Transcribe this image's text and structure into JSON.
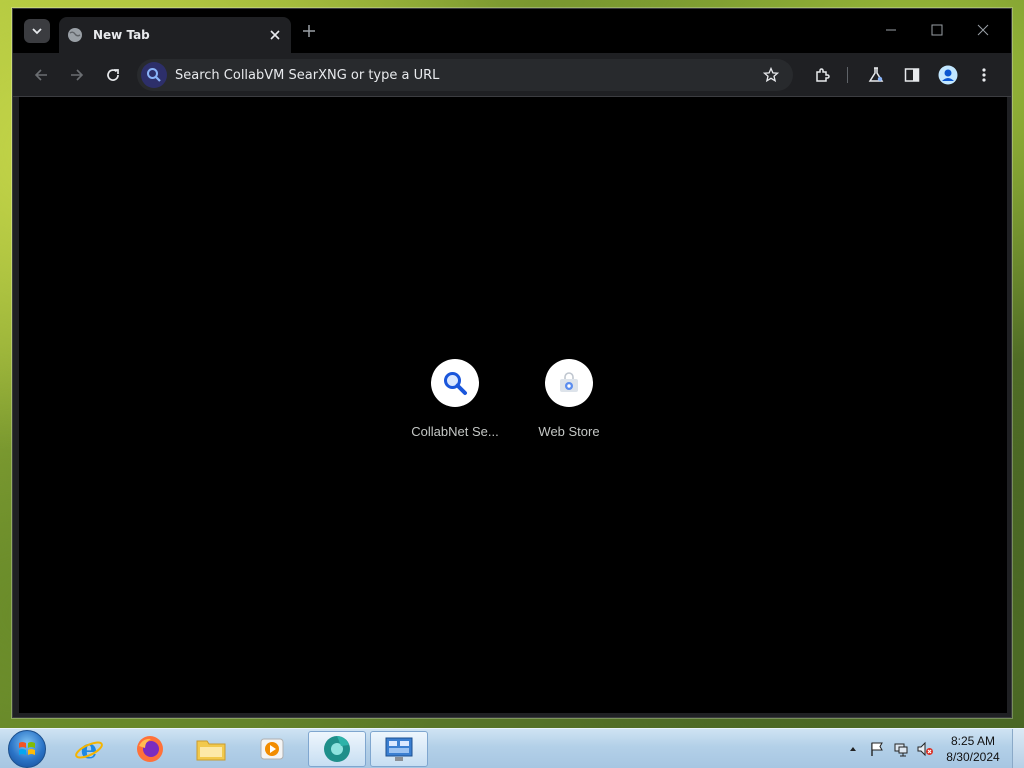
{
  "browser": {
    "tab": {
      "title": "New Tab"
    },
    "omnibox": {
      "placeholder": "Search CollabVM SearXNG or type a URL"
    },
    "shortcuts": [
      {
        "label": "CollabNet Se...",
        "icon": "magnifier-icon"
      },
      {
        "label": "Web Store",
        "icon": "web-store-icon"
      }
    ],
    "colors": {
      "accent": "#2d2f6a",
      "background": "#000000",
      "toolbar": "#1f2023"
    }
  },
  "taskbar": {
    "apps": [
      {
        "name": "internet-explorer",
        "icon": "ie-icon"
      },
      {
        "name": "firefox",
        "icon": "firefox-icon"
      },
      {
        "name": "file-explorer",
        "icon": "folder-icon"
      },
      {
        "name": "media-player",
        "icon": "media-player-icon"
      },
      {
        "name": "chromium",
        "icon": "browser-icon"
      },
      {
        "name": "control-panel",
        "icon": "control-panel-icon"
      }
    ],
    "clock": {
      "time": "8:25 AM",
      "date": "8/30/2024"
    }
  }
}
